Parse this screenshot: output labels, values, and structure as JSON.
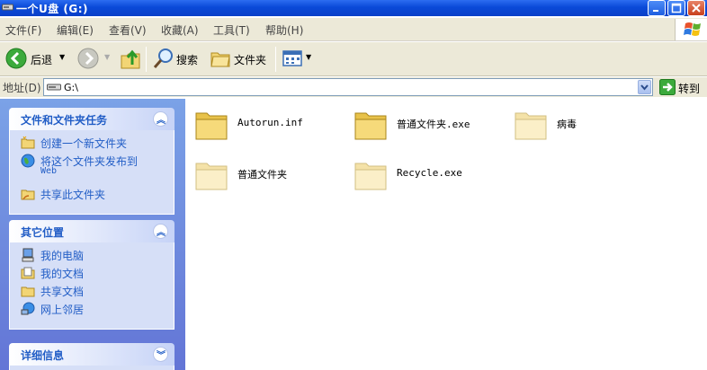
{
  "window": {
    "title": "一个U盘 (G:)"
  },
  "menu": [
    "文件(F)",
    "编辑(E)",
    "查看(V)",
    "收藏(A)",
    "工具(T)",
    "帮助(H)"
  ],
  "toolbar": {
    "back_label": "后退",
    "search_label": "搜索",
    "folders_label": "文件夹"
  },
  "address": {
    "label": "地址(D)",
    "value": "G:\\",
    "go_label": "转到"
  },
  "left_panel": {
    "tasks": {
      "title": "文件和文件夹任务",
      "items": [
        "创建一个新文件夹",
        "将这个文件夹发布到",
        "Web",
        "共享此文件夹"
      ]
    },
    "places": {
      "title": "其它位置",
      "items": [
        "我的电脑",
        "我的文档",
        "共享文档",
        "网上邻居"
      ]
    },
    "details": {
      "title": "详细信息"
    }
  },
  "files": [
    {
      "name": "Autorun.inf",
      "icon": "folder-icon"
    },
    {
      "name": "普通文件夹.exe",
      "icon": "folder-icon"
    },
    {
      "name": "病毒",
      "icon": "folder-faded-icon"
    },
    {
      "name": "普通文件夹",
      "icon": "folder-faded-icon"
    },
    {
      "name": "Recycle.exe",
      "icon": "folder-faded-icon"
    }
  ]
}
